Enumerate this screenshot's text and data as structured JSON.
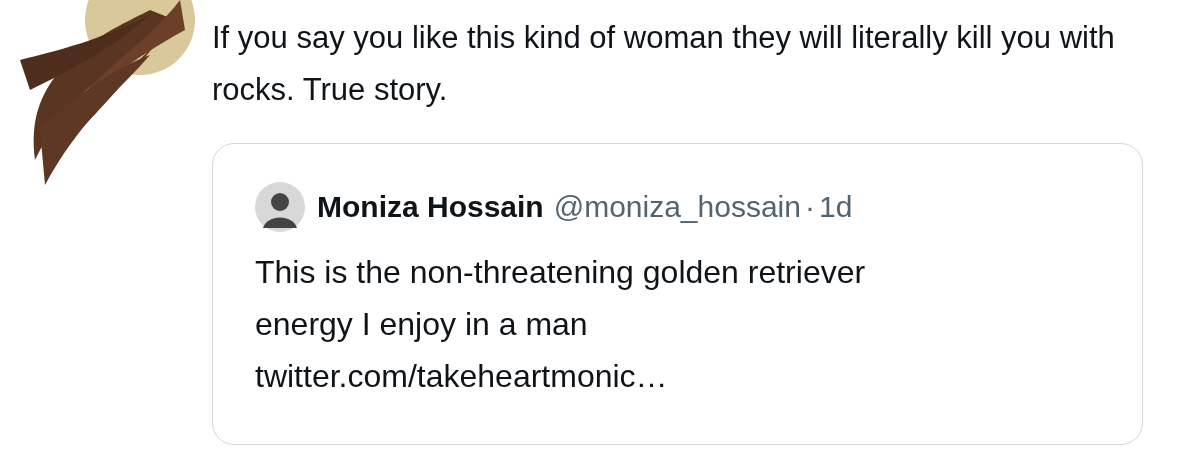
{
  "tweet": {
    "text": "If you say you like this kind of woman they will literally kill you with rocks. True story."
  },
  "quoted_tweet": {
    "name": "Moniza Hossain",
    "handle": "@moniza_hossain",
    "separator": "·",
    "time": "1d",
    "text": "This is the non-threatening golden retriever energy I enjoy in a man",
    "link": "twitter.com/takeheartmonic…"
  }
}
